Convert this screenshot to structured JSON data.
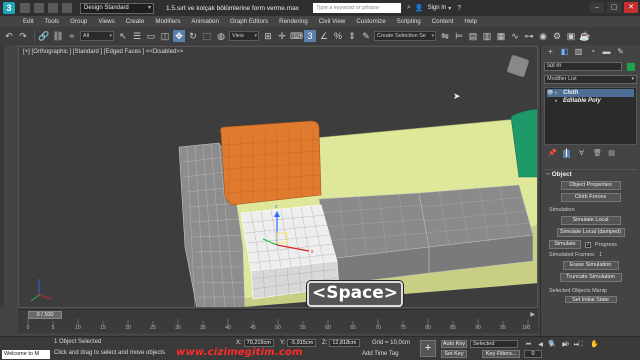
{
  "titlebar": {
    "logo_letter": "3",
    "workspace": "Design Standard",
    "document_title": "1.5.sırt ve kolçak bölümlerine form verme.max",
    "search_placeholder": "Type a keyword or phrase",
    "sign_in": "Sign In"
  },
  "menu": [
    "Edit",
    "Tools",
    "Group",
    "Views",
    "Create",
    "Modifiers",
    "Animation",
    "Graph Editors",
    "Rendering",
    "Civil View",
    "Customize",
    "Scripting",
    "Content",
    "Help"
  ],
  "toolbar": {
    "filter": "All",
    "coord_system": "View",
    "selection_set": "Create Selection Se"
  },
  "viewport": {
    "label": "[+] [Orthographic ] [Standard ] [Edged Faces ]  <<Disabled>>",
    "overlay_key": "<Space>",
    "colors": {
      "sofa_base": "#dfe79a",
      "cushion": "#8a8a8a",
      "pillow": "#e07a2e",
      "green_pillow": "#1e9a6a"
    }
  },
  "command_panel": {
    "object_name": "sol m",
    "object_color": "#1aa34a",
    "modifier_list": "Modifier List",
    "stack": [
      {
        "label": "Cloth",
        "selected": true
      },
      {
        "label": "Editable Poly",
        "selected": false
      }
    ],
    "rollout_title": "Object",
    "object_properties": "Object Properties",
    "cloth_forces": "Cloth Forces",
    "simulation_label": "Simulation",
    "simulate_local": "Simulate Local",
    "simulate_local_damped": "Simulate Local (damped)",
    "simulate": "Simulate",
    "progress": "Progress",
    "progress_checked": "✓",
    "simulated_frames_label": "Simulated Frames:",
    "simulated_frames": "1",
    "erase_simulation": "Erase Simulation",
    "truncate_simulation": "Truncate Simulation",
    "selected_objects_manip": "Selected Objects Manip",
    "set_initial_state": "Set Initial State"
  },
  "timeline": {
    "frame_counter": "0 / 100",
    "ticks": [
      "0",
      "5",
      "10",
      "15",
      "20",
      "25",
      "30",
      "35",
      "40",
      "45",
      "50",
      "55",
      "60",
      "65",
      "70",
      "75",
      "80",
      "85",
      "90",
      "95",
      "100"
    ]
  },
  "status": {
    "maxscript": "Welcome to M",
    "line1": "1 Object Selected",
    "line2": "Click and drag to select and move objects",
    "x_label": "X:",
    "x_value": "79,219cm",
    "y_label": "Y:",
    "y_value": "-5,915cm",
    "z_label": "Z:",
    "z_value": "12,818cm",
    "grid": "Grid = 10,0cm",
    "add_time_tag": "Add Time Tag",
    "watermark": "www.cizimegitim.com",
    "auto_key": "Auto Key",
    "selected": "Selected",
    "set_key": "Set Key",
    "key_filters": "Key Filters...",
    "current_frame": "0"
  }
}
